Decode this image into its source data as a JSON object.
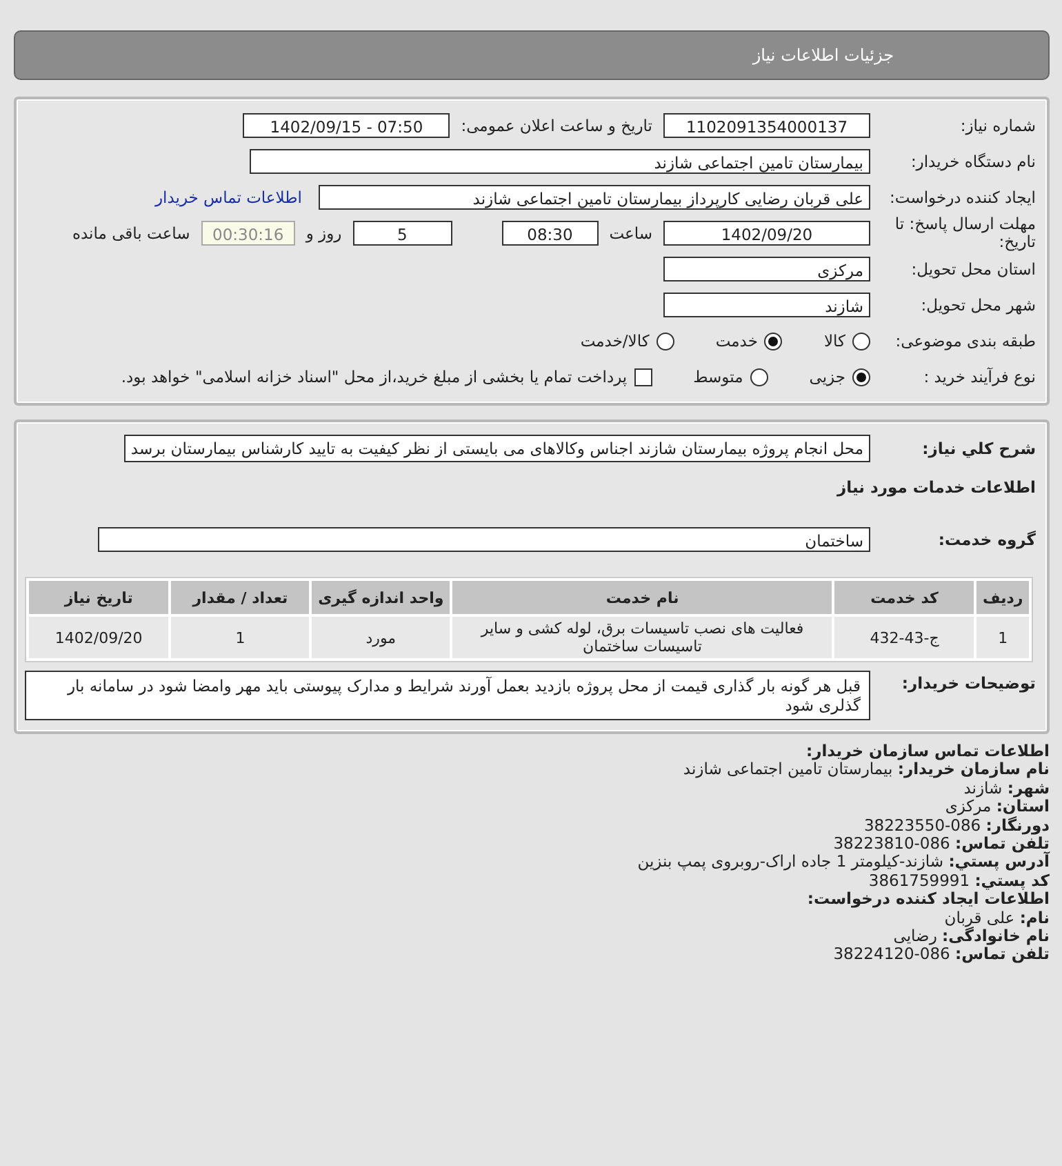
{
  "header": {
    "title": "جزئیات اطلاعات نیاز"
  },
  "fields": {
    "need_number": {
      "label": "شماره نیاز:",
      "value": "1102091354000137"
    },
    "announce": {
      "label": "تاریخ و ساعت اعلان عمومی:",
      "value": "1402/09/15 - 07:50"
    },
    "buyer_org": {
      "label": "نام دستگاه خریدار:",
      "value": "بیمارستان تامین اجتماعی شازند"
    },
    "requester": {
      "label": "ایجاد کننده درخواست:",
      "value": "علی قربان  رضایی کارپرداز بیمارستان تامین اجتماعی شازند",
      "link": "اطلاعات تماس خریدار"
    },
    "deadline": {
      "label": "مهلت ارسال پاسخ: تا تاریخ:",
      "date": "1402/09/20",
      "time_label": "ساعت",
      "time": "08:30",
      "days": "5",
      "days_label": "روز و",
      "remaining": "00:30:16",
      "remaining_label": "ساعت باقی مانده"
    },
    "province": {
      "label": "استان محل تحویل:",
      "value": "مرکزی"
    },
    "city": {
      "label": "شهر محل تحویل:",
      "value": "شازند"
    },
    "category": {
      "label": "طبقه بندی موضوعی:",
      "options": [
        {
          "label": "کالا",
          "selected": false
        },
        {
          "label": "خدمت",
          "selected": true
        },
        {
          "label": "کالا/خدمت",
          "selected": false
        }
      ]
    },
    "process": {
      "label": "نوع فرآیند خرید :",
      "options": [
        {
          "label": "جزیی",
          "selected": true
        },
        {
          "label": "متوسط",
          "selected": false
        }
      ],
      "checkbox": {
        "label": "پرداخت تمام یا بخشی از مبلغ خرید،از محل \"اسناد خزانه اسلامی\" خواهد بود.",
        "checked": false
      }
    }
  },
  "description": {
    "label": "شرح کلي نياز:",
    "value": "محل انجام پروژه بیمارستان شازند اجناس وکالاهای می بایستی از نظر کیفیت به تایید کارشناس بیمارستان برسد"
  },
  "services_heading": "اطلاعات خدمات مورد نیاز",
  "service_group": {
    "label": "گروه خدمت:",
    "value": "ساختمان"
  },
  "table": {
    "columns": [
      "ردیف",
      "کد خدمت",
      "نام خدمت",
      "واحد اندازه گیری",
      "تعداد / مقدار",
      "تاریخ نیاز"
    ],
    "rows": [
      [
        "1",
        "ج-43-432",
        "فعالیت های نصب تاسیسات برق، لوله کشی و سایر تاسیسات ساختمان",
        "مورد",
        "1",
        "1402/09/20"
      ]
    ]
  },
  "buyer_notes": {
    "label": "توضیحات خریدار:",
    "value": "قبل هر گونه بار گذاری قیمت از محل پروژه بازدید بعمل آورند شرایط و مدارک پیوستی باید مهر وامضا شود در سامانه بار گذلری شود"
  },
  "contact": [
    {
      "kind": "heading",
      "text": "اطلاعات تماس سازمان خریدار:"
    },
    {
      "kind": "pair",
      "label": "نام سازمان خریدار:",
      "value": "بیمارستان تامین اجتماعی شازند"
    },
    {
      "kind": "pair",
      "label": "شهر:",
      "value": "شازند"
    },
    {
      "kind": "pair",
      "label": "استان:",
      "value": "مرکزی"
    },
    {
      "kind": "pair",
      "label": "دورنگار:",
      "value": "38223550-086"
    },
    {
      "kind": "pair",
      "label": "تلفن تماس:",
      "value": "38223810-086"
    },
    {
      "kind": "pair",
      "label": "آدرس پستي:",
      "value": "شازند-کیلومتر 1 جاده اراک-روبروی پمپ بنزین"
    },
    {
      "kind": "pair",
      "label": "کد پستي:",
      "value": "3861759991"
    },
    {
      "kind": "heading",
      "text": "اطلاعات ایجاد کننده درخواست:"
    },
    {
      "kind": "pair",
      "label": "نام:",
      "value": "علی قربان"
    },
    {
      "kind": "pair",
      "label": "نام خانوادگی:",
      "value": "رضایی"
    },
    {
      "kind": "pair",
      "label": "تلفن تماس:",
      "value": "38224120-086"
    }
  ]
}
